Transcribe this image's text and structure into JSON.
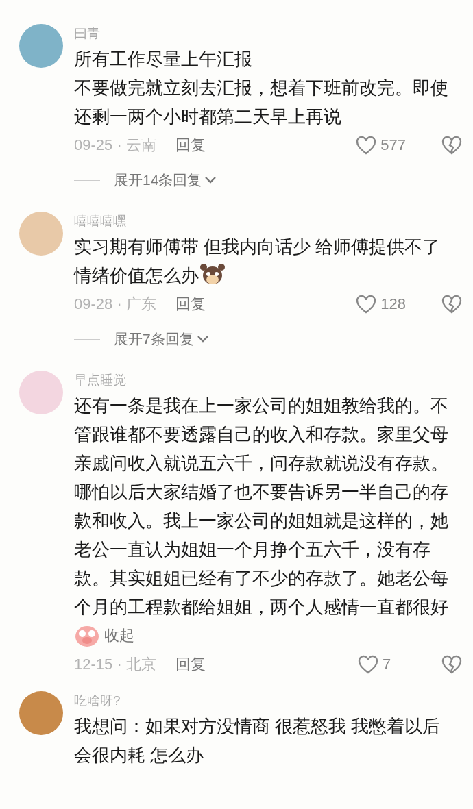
{
  "comments": [
    {
      "name": "曰青",
      "paragraphs": [
        "所有工作尽量上午汇报",
        "不要做完就立刻去汇报，想着下班前改完。即使还剩一两个小时都第二天早上再说"
      ],
      "date_region": "09-25 · 云南",
      "reply": "回复",
      "likes": "577",
      "expand": "展开14条回复"
    },
    {
      "name": "嘻嘻嘻嘿",
      "paragraphs": [
        "实习期有师傅带 但我内向话少 给师傅提供不了情绪价值怎么办"
      ],
      "sticker": {
        "kind": "dog"
      },
      "date_region": "09-28 · 广东",
      "reply": "回复",
      "likes": "128",
      "expand": "展开7条回复"
    },
    {
      "name": "早点睡觉",
      "paragraphs": [
        "还有一条是我在上一家公司的姐姐教给我的。不管跟谁都不要透露自己的收入和存款。家里父母亲戚问收入就说五六千，问存款就说没有存款。哪怕以后大家结婚了也不要告诉另一半自己的存款和收入。我上一家公司的姐姐就是这样的，她老公一直认为姐姐一个月挣个五六千，没有存款。其实姐姐已经有了不少的存款了。她老公每个月的工程款都给姐姐，两个人感情一直都很好"
      ],
      "end_sticker": {
        "kind": "pig"
      },
      "collapse": "收起",
      "date_region": "12-15 · 北京",
      "reply": "回复",
      "likes": "7"
    },
    {
      "name": "吃啥呀?",
      "paragraphs": [
        "我想问：如果对方没情商 很惹怒我 我憋着以后会很内耗 怎么办"
      ]
    }
  ]
}
